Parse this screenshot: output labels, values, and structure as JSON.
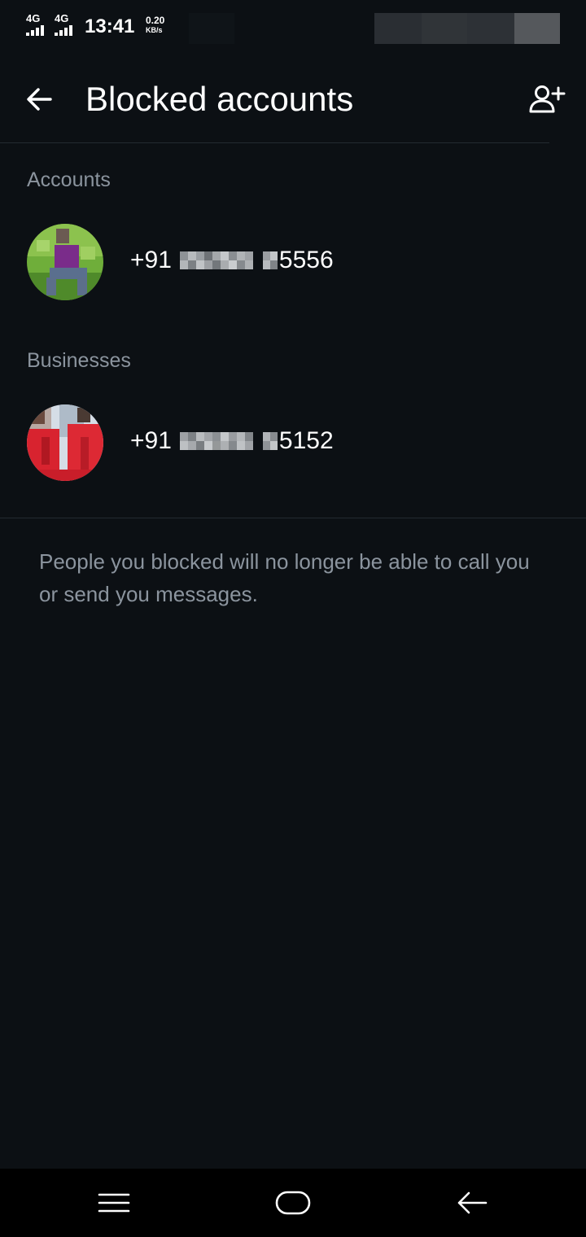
{
  "status_bar": {
    "network_1": "4G",
    "network_2": "4G",
    "time": "13:41",
    "speed_value": "0.20",
    "speed_unit": "KB/s"
  },
  "header": {
    "title": "Blocked accounts",
    "back_icon": "arrow-left-icon",
    "add_icon": "add-person-icon"
  },
  "sections": {
    "accounts_label": "Accounts",
    "businesses_label": "Businesses"
  },
  "accounts": [
    {
      "prefix": "+91",
      "suffix": "5556"
    }
  ],
  "businesses": [
    {
      "prefix": "+91",
      "suffix": "5152"
    }
  ],
  "info_text": "People you blocked will no longer be able to call you or send you messages.",
  "navigation": {
    "menu_icon": "menu-icon",
    "home_icon": "home-pill-icon",
    "back_icon": "back-arrow-icon"
  },
  "colors": {
    "background": "#0c1014",
    "secondary_text": "#8b949e",
    "divider": "#232a31",
    "nav_background": "#000000"
  }
}
